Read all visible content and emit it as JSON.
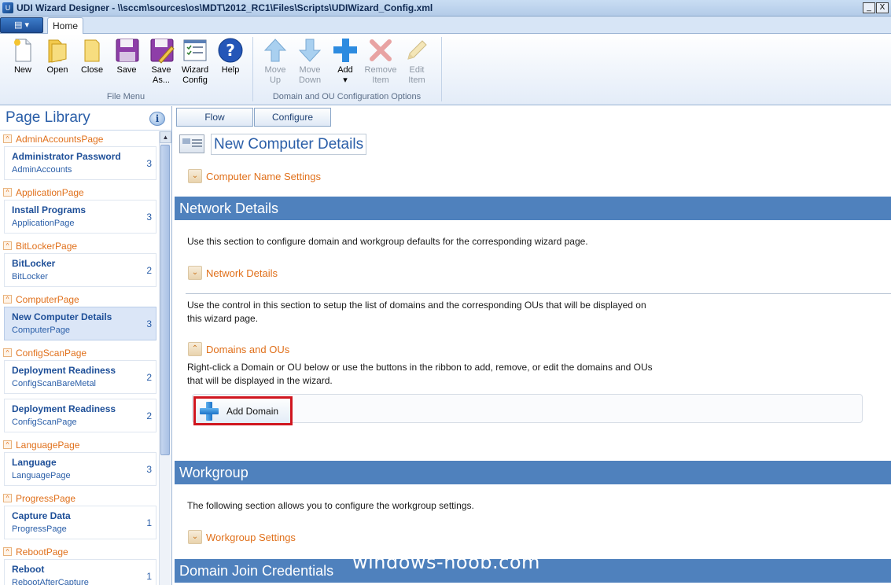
{
  "window": {
    "title": "UDI Wizard Designer - \\\\sccm\\sources\\os\\MDT\\2012_RC1\\Files\\Scripts\\UDIWizard_Config.xml",
    "minimize": "_",
    "close": "X"
  },
  "tabs": {
    "home": "Home"
  },
  "ribbon": {
    "file_group_label": "File Menu",
    "domain_group_label": "Domain and OU Configuration Options",
    "buttons": {
      "new": "New",
      "open": "Open",
      "close": "Close",
      "save": "Save",
      "save_as_1": "Save",
      "save_as_2": "As...",
      "wizard_config_1": "Wizard",
      "wizard_config_2": "Config",
      "help": "Help",
      "move_up_1": "Move",
      "move_up_2": "Up",
      "move_down_1": "Move",
      "move_down_2": "Down",
      "add": "Add",
      "add_caret": "▾",
      "remove_item_1": "Remove",
      "remove_item_2": "Item",
      "edit_item_1": "Edit",
      "edit_item_2": "Item"
    }
  },
  "page_library": {
    "title": "Page Library",
    "info": "i",
    "categories": [
      {
        "name": "AdminAccountsPage",
        "items": [
          {
            "name": "Administrator Password",
            "type": "AdminAccounts",
            "count": "3"
          }
        ]
      },
      {
        "name": "ApplicationPage",
        "items": [
          {
            "name": "Install Programs",
            "type": "ApplicationPage",
            "count": "3"
          }
        ]
      },
      {
        "name": "BitLockerPage",
        "items": [
          {
            "name": "BitLocker",
            "type": "BitLocker",
            "count": "2"
          }
        ]
      },
      {
        "name": "ComputerPage",
        "items": [
          {
            "name": "New Computer Details",
            "type": "ComputerPage",
            "count": "3"
          }
        ]
      },
      {
        "name": "ConfigScanPage",
        "items": [
          {
            "name": "Deployment Readiness",
            "type": "ConfigScanBareMetal",
            "count": "2"
          },
          {
            "name": "Deployment Readiness",
            "type": "ConfigScanPage",
            "count": "2"
          }
        ]
      },
      {
        "name": "LanguagePage",
        "items": [
          {
            "name": "Language",
            "type": "LanguagePage",
            "count": "3"
          }
        ]
      },
      {
        "name": "ProgressPage",
        "items": [
          {
            "name": "Capture Data",
            "type": "ProgressPage",
            "count": "1"
          }
        ]
      },
      {
        "name": "RebootPage",
        "items": [
          {
            "name": "Reboot",
            "type": "RebootAfterCapture",
            "count": "1"
          }
        ]
      }
    ]
  },
  "view_tabs": {
    "flow": "Flow",
    "configure": "Configure"
  },
  "page": {
    "title": "New Computer Details",
    "computer_name_settings": "Computer Name Settings",
    "network_details_band": "Network Details",
    "network_desc": "Use this section to configure domain and workgroup defaults for the corresponding wizard page.",
    "network_details_toggle": "Network Details",
    "domains_desc_1": "Use the control in this section to setup the list of domains and the corresponding OUs that will be displayed on",
    "domains_desc_2": "this wizard page.",
    "domains_toggle": "Domains and OUs",
    "rightclick_desc_1": "Right-click a Domain or OU below or use the buttons in the ribbon to add, remove, or edit the domains and OUs",
    "rightclick_desc_2": "that will be displayed in the wizard.",
    "add_domain": "Add Domain",
    "workgroup_band": "Workgroup",
    "workgroup_desc": "The following section allows you to configure the workgroup settings.",
    "workgroup_toggle": "Workgroup Settings",
    "domain_join_band": "Domain Join Credentials"
  },
  "watermark": "windows-noob.com",
  "colors": {
    "band": "#4f81bd",
    "accent_orange": "#e0701b",
    "highlight_red": "#d0161f",
    "link_blue": "#1e4f98"
  }
}
